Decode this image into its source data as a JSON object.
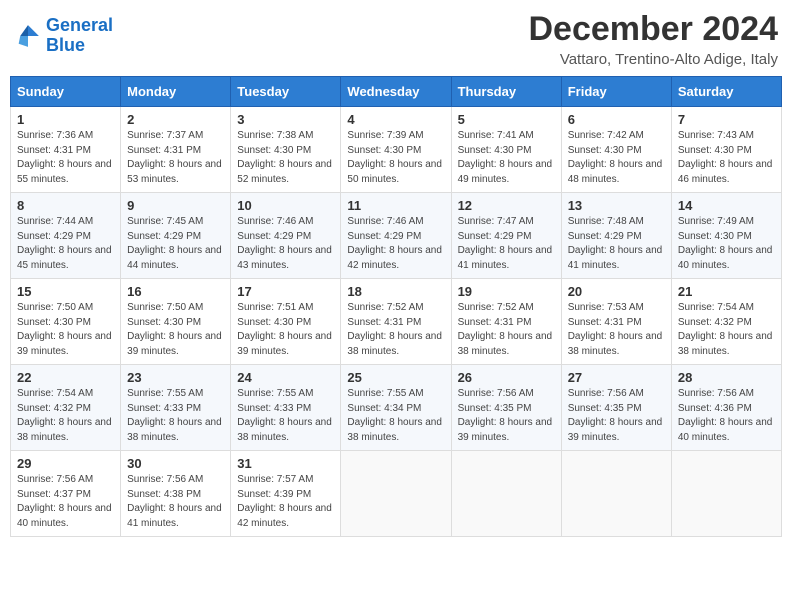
{
  "logo": {
    "line1": "General",
    "line2": "Blue"
  },
  "header": {
    "month": "December 2024",
    "location": "Vattaro, Trentino-Alto Adige, Italy"
  },
  "weekdays": [
    "Sunday",
    "Monday",
    "Tuesday",
    "Wednesday",
    "Thursday",
    "Friday",
    "Saturday"
  ],
  "weeks": [
    [
      {
        "day": 1,
        "sunrise": "7:36 AM",
        "sunset": "4:31 PM",
        "daylight": "8 hours and 55 minutes."
      },
      {
        "day": 2,
        "sunrise": "7:37 AM",
        "sunset": "4:31 PM",
        "daylight": "8 hours and 53 minutes."
      },
      {
        "day": 3,
        "sunrise": "7:38 AM",
        "sunset": "4:30 PM",
        "daylight": "8 hours and 52 minutes."
      },
      {
        "day": 4,
        "sunrise": "7:39 AM",
        "sunset": "4:30 PM",
        "daylight": "8 hours and 50 minutes."
      },
      {
        "day": 5,
        "sunrise": "7:41 AM",
        "sunset": "4:30 PM",
        "daylight": "8 hours and 49 minutes."
      },
      {
        "day": 6,
        "sunrise": "7:42 AM",
        "sunset": "4:30 PM",
        "daylight": "8 hours and 48 minutes."
      },
      {
        "day": 7,
        "sunrise": "7:43 AM",
        "sunset": "4:30 PM",
        "daylight": "8 hours and 46 minutes."
      }
    ],
    [
      {
        "day": 8,
        "sunrise": "7:44 AM",
        "sunset": "4:29 PM",
        "daylight": "8 hours and 45 minutes."
      },
      {
        "day": 9,
        "sunrise": "7:45 AM",
        "sunset": "4:29 PM",
        "daylight": "8 hours and 44 minutes."
      },
      {
        "day": 10,
        "sunrise": "7:46 AM",
        "sunset": "4:29 PM",
        "daylight": "8 hours and 43 minutes."
      },
      {
        "day": 11,
        "sunrise": "7:46 AM",
        "sunset": "4:29 PM",
        "daylight": "8 hours and 42 minutes."
      },
      {
        "day": 12,
        "sunrise": "7:47 AM",
        "sunset": "4:29 PM",
        "daylight": "8 hours and 41 minutes."
      },
      {
        "day": 13,
        "sunrise": "7:48 AM",
        "sunset": "4:29 PM",
        "daylight": "8 hours and 41 minutes."
      },
      {
        "day": 14,
        "sunrise": "7:49 AM",
        "sunset": "4:30 PM",
        "daylight": "8 hours and 40 minutes."
      }
    ],
    [
      {
        "day": 15,
        "sunrise": "7:50 AM",
        "sunset": "4:30 PM",
        "daylight": "8 hours and 39 minutes."
      },
      {
        "day": 16,
        "sunrise": "7:50 AM",
        "sunset": "4:30 PM",
        "daylight": "8 hours and 39 minutes."
      },
      {
        "day": 17,
        "sunrise": "7:51 AM",
        "sunset": "4:30 PM",
        "daylight": "8 hours and 39 minutes."
      },
      {
        "day": 18,
        "sunrise": "7:52 AM",
        "sunset": "4:31 PM",
        "daylight": "8 hours and 38 minutes."
      },
      {
        "day": 19,
        "sunrise": "7:52 AM",
        "sunset": "4:31 PM",
        "daylight": "8 hours and 38 minutes."
      },
      {
        "day": 20,
        "sunrise": "7:53 AM",
        "sunset": "4:31 PM",
        "daylight": "8 hours and 38 minutes."
      },
      {
        "day": 21,
        "sunrise": "7:54 AM",
        "sunset": "4:32 PM",
        "daylight": "8 hours and 38 minutes."
      }
    ],
    [
      {
        "day": 22,
        "sunrise": "7:54 AM",
        "sunset": "4:32 PM",
        "daylight": "8 hours and 38 minutes."
      },
      {
        "day": 23,
        "sunrise": "7:55 AM",
        "sunset": "4:33 PM",
        "daylight": "8 hours and 38 minutes."
      },
      {
        "day": 24,
        "sunrise": "7:55 AM",
        "sunset": "4:33 PM",
        "daylight": "8 hours and 38 minutes."
      },
      {
        "day": 25,
        "sunrise": "7:55 AM",
        "sunset": "4:34 PM",
        "daylight": "8 hours and 38 minutes."
      },
      {
        "day": 26,
        "sunrise": "7:56 AM",
        "sunset": "4:35 PM",
        "daylight": "8 hours and 39 minutes."
      },
      {
        "day": 27,
        "sunrise": "7:56 AM",
        "sunset": "4:35 PM",
        "daylight": "8 hours and 39 minutes."
      },
      {
        "day": 28,
        "sunrise": "7:56 AM",
        "sunset": "4:36 PM",
        "daylight": "8 hours and 40 minutes."
      }
    ],
    [
      {
        "day": 29,
        "sunrise": "7:56 AM",
        "sunset": "4:37 PM",
        "daylight": "8 hours and 40 minutes."
      },
      {
        "day": 30,
        "sunrise": "7:56 AM",
        "sunset": "4:38 PM",
        "daylight": "8 hours and 41 minutes."
      },
      {
        "day": 31,
        "sunrise": "7:57 AM",
        "sunset": "4:39 PM",
        "daylight": "8 hours and 42 minutes."
      },
      null,
      null,
      null,
      null
    ]
  ],
  "labels": {
    "sunrise": "Sunrise:",
    "sunset": "Sunset:",
    "daylight": "Daylight:"
  }
}
